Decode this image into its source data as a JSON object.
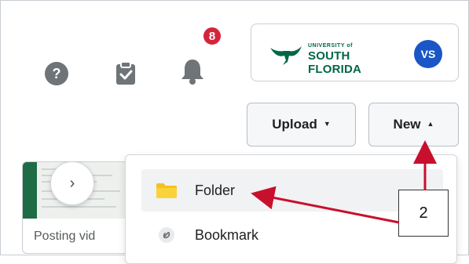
{
  "header": {
    "help_icon": "help-circle-icon",
    "tasks_icon": "clipboard-check-icon",
    "notifications_icon": "bell-icon",
    "notification_count": "8"
  },
  "account": {
    "org_small": "UNIVERSITY of",
    "org_large": "SOUTH FLORIDA",
    "avatar_initials": "VS",
    "brand_color": "#006747",
    "avatar_color": "#1a56c6"
  },
  "toolbar": {
    "upload_label": "Upload",
    "new_label": "New"
  },
  "thumbnail": {
    "caption": "Posting vid"
  },
  "menu": {
    "items": [
      {
        "label": "Folder",
        "icon": "folder-icon"
      },
      {
        "label": "Bookmark",
        "icon": "bookmark-link-icon"
      }
    ]
  },
  "annotation": {
    "callout_number": "2",
    "arrow_color": "#c8102e"
  }
}
